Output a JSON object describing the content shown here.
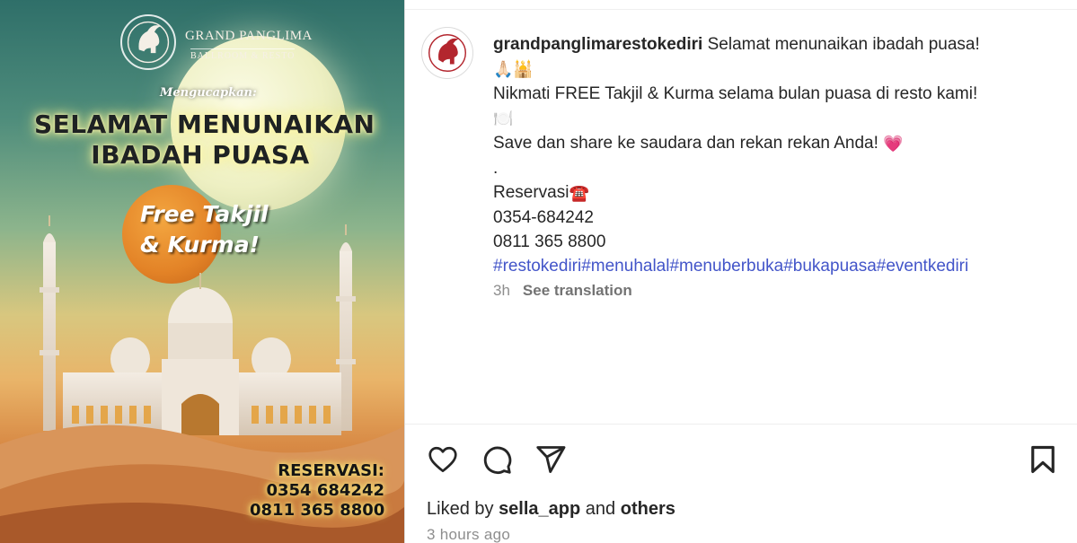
{
  "post_image": {
    "brand_name": "GRAND PANGLIMA",
    "brand_sub": "BALLROOM & RESTO",
    "intro": "Mengucapkan:",
    "greeting_line1": "SELAMAT MENUNAIKAN",
    "greeting_line2": "IBADAH PUASA",
    "promo_line1": "Free Takjil",
    "promo_line2": "& Kurma!",
    "reservation_label": "RESERVASI:",
    "phone1": "0354 684242",
    "phone2": "0811 365 8800"
  },
  "post": {
    "username": "grandpanglimarestokediri",
    "caption_line1": "Selamat menunaikan ibadah puasa!",
    "caption_line2_emoji": "🙏🏻🕌",
    "caption_line3": "Nikmati FREE Takjil & Kurma selama bulan puasa di resto kami!",
    "caption_line4_emoji": "🍽️",
    "caption_line5": "Save dan share ke saudara dan rekan rekan Anda!",
    "caption_line5_emoji": "💗",
    "caption_dot": ".",
    "reservasi_label": "Reservasi",
    "reservasi_emoji": "☎️",
    "phone1": "0354-684242",
    "phone2": "0811 365 8800",
    "hashtags": [
      "#restokediri",
      "#menuhalal",
      "#menuberbuka",
      "#bukapuasa",
      "#eventkediri"
    ],
    "time_ago": "3h",
    "see_translation": "See translation"
  },
  "engagement": {
    "liked_by_prefix": "Liked by",
    "liked_by_user": "sella_app",
    "liked_by_and": "and",
    "liked_by_others": "others",
    "posted_ago": "3 hours ago"
  },
  "icons": {
    "like": "heart-icon",
    "comment": "comment-icon",
    "share": "share-icon",
    "save": "bookmark-icon"
  },
  "colors": {
    "hashtag": "#4355c9",
    "muted": "#8e8e8e",
    "brand_red": "#b3262e"
  }
}
